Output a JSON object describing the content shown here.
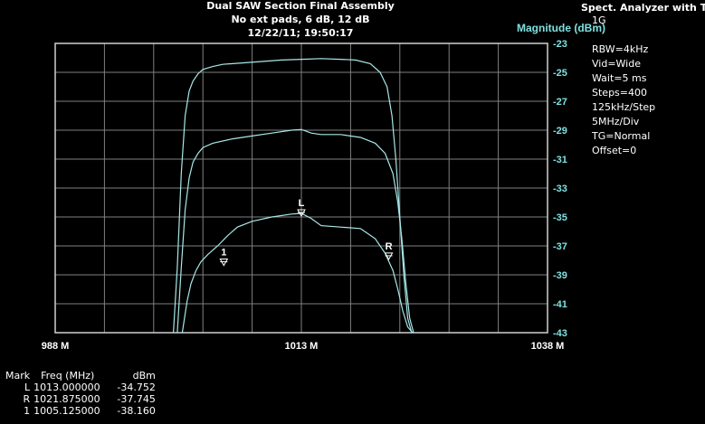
{
  "window": {
    "title_lines": [
      "Dual SAW Section Final Assembly",
      "No ext pads, 6 dB, 12 dB",
      "12/22/11; 19:50:17"
    ]
  },
  "sidebar": {
    "heading": "Spect. Analyzer with TG",
    "lines": [
      "1G",
      "RBW=4kHz",
      "Vid=Wide",
      "Wait=5 ms",
      "Steps=400",
      "125kHz/Step",
      "5MHz/Div",
      "TG=Normal",
      "Offset=0"
    ]
  },
  "markers": {
    "headers": [
      "Mark",
      "Freq (MHz)",
      "dBm"
    ],
    "rows": [
      {
        "mark": "L",
        "freq": "1013.000000",
        "dbm": "-34.752"
      },
      {
        "mark": "R",
        "freq": "1021.875000",
        "dbm": "-37.745"
      },
      {
        "mark": "1",
        "freq": "1005.125000",
        "dbm": "-38.160"
      }
    ]
  },
  "colors": {
    "background": "#000000",
    "grid": "#808080",
    "trace": "#a8e8e8",
    "axis_label": "#7fe0e0",
    "text": "#ffffff",
    "plot_frame": "#d0d0d0"
  },
  "chart_data": {
    "type": "line",
    "title": "Dual SAW Section Final Assembly",
    "subtitle": "No ext pads, 6 dB, 12 dB",
    "ylabel": "Magnitude (dBm)",
    "xlabel": "",
    "xlim": [
      988,
      1038
    ],
    "ylim": [
      -43,
      -23
    ],
    "x_ticks": [
      {
        "value": 988,
        "label": "988 M"
      },
      {
        "value": 1013,
        "label": "1013 M"
      },
      {
        "value": 1038,
        "label": "1038 M"
      }
    ],
    "y_ticks": [
      -23,
      -25,
      -27,
      -29,
      -31,
      -33,
      -35,
      -37,
      -39,
      -41,
      -43
    ],
    "x_grid_step": 5,
    "grid": true,
    "series": [
      {
        "x": [
          1000.0,
          1000.4,
          1000.8,
          1001.2,
          1001.6,
          1002.0,
          1002.5,
          1003.0,
          1004.0,
          1005.0,
          1007.0,
          1009.0,
          1011.0,
          1013.0,
          1015.0,
          1017.0,
          1018.5,
          1020.0,
          1021.0,
          1021.7,
          1022.2,
          1022.6,
          1023.0,
          1023.4,
          1023.8,
          1024.2
        ],
        "y": [
          -43.0,
          -38.5,
          -32.0,
          -28.0,
          -26.3,
          -25.6,
          -25.1,
          -24.8,
          -24.6,
          -24.45,
          -24.35,
          -24.25,
          -24.15,
          -24.1,
          -24.05,
          -24.1,
          -24.15,
          -24.4,
          -25.0,
          -26.0,
          -28.0,
          -31.0,
          -35.0,
          -39.0,
          -42.0,
          -43.0
        ]
      },
      {
        "x": [
          1000.4,
          1000.8,
          1001.2,
          1001.6,
          1002.0,
          1002.5,
          1003.0,
          1004.0,
          1006.0,
          1008.0,
          1010.0,
          1012.0,
          1013.0,
          1014.0,
          1015.0,
          1017.0,
          1019.0,
          1020.5,
          1021.5,
          1022.3,
          1022.8,
          1023.2,
          1023.6,
          1024.0,
          1024.4
        ],
        "y": [
          -43.0,
          -38.5,
          -34.5,
          -32.3,
          -31.2,
          -30.6,
          -30.2,
          -29.9,
          -29.6,
          -29.4,
          -29.2,
          -29.0,
          -28.95,
          -29.2,
          -29.3,
          -29.3,
          -29.5,
          -29.9,
          -30.6,
          -32.0,
          -34.0,
          -36.5,
          -39.5,
          -42.0,
          -43.0
        ]
      },
      {
        "x": [
          1000.9,
          1001.4,
          1001.8,
          1002.3,
          1002.8,
          1003.5,
          1004.5,
          1005.5,
          1006.5,
          1008.0,
          1010.0,
          1012.0,
          1013.0,
          1014.0,
          1015.0,
          1017.0,
          1019.0,
          1020.5,
          1021.5,
          1022.3,
          1022.8,
          1023.3,
          1023.8,
          1024.3
        ],
        "y": [
          -43.0,
          -40.8,
          -39.6,
          -38.7,
          -38.1,
          -37.6,
          -37.0,
          -36.3,
          -35.7,
          -35.3,
          -35.0,
          -34.8,
          -34.75,
          -35.1,
          -35.6,
          -35.7,
          -35.8,
          -36.5,
          -37.5,
          -38.7,
          -40.0,
          -41.5,
          -42.6,
          -43.0
        ]
      }
    ],
    "marker_points": [
      {
        "label": "L",
        "x": 1013.0,
        "y": -34.752
      },
      {
        "label": "R",
        "x": 1021.875,
        "y": -37.745
      },
      {
        "label": "1",
        "x": 1005.125,
        "y": -38.16
      }
    ]
  }
}
